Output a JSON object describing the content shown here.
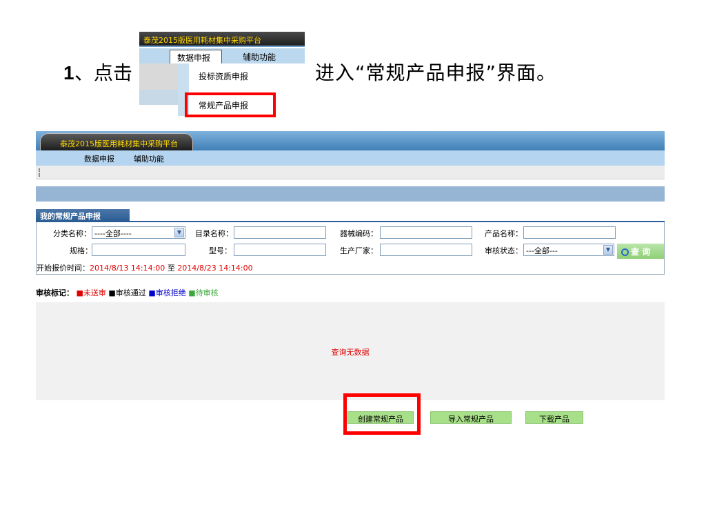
{
  "instruction": {
    "number": "1",
    "pre": "、点击",
    "post": "进入“常规产品申报”界面。"
  },
  "mini_menu": {
    "platform_title": "泰茂2015版医用耗材集中采购平台",
    "menu_data_declare": "数据申报",
    "menu_aux": "辅助功能",
    "dropdown_item_1": "投标资质申报",
    "dropdown_item_2": "常规产品申报"
  },
  "header": {
    "platform_title": "泰茂2015版医用耗材集中采购平台"
  },
  "nav": {
    "items": [
      {
        "label": "数据申报"
      },
      {
        "label": "辅助功能"
      }
    ]
  },
  "panel": {
    "tab_title": "我的常规产品申报"
  },
  "form": {
    "category_label": "分类名称：",
    "category_value": "----全部----",
    "catalog_label": "目录名称：",
    "device_code_label": "器械编码：",
    "product_name_label": "产品名称：",
    "spec_label": "规格：",
    "model_label": "型号：",
    "manufacturer_label": "生产厂家：",
    "audit_status_label": "审核状态：",
    "audit_status_value": "---全部---",
    "query_button": "查 询",
    "time_label": "开始报价时间：",
    "time_start": "2014/8/13 14:14:00",
    "time_to": "至",
    "time_end": "2014/8/23 14:14:00"
  },
  "legend": {
    "title": "审核标记：",
    "items": [
      {
        "label": "■未送审",
        "color": "#e00000"
      },
      {
        "label": "■审核通过",
        "color": "#000000"
      },
      {
        "label": "■审核拒绝",
        "color": "#0000cc"
      },
      {
        "label": "■待审核",
        "color": "#3aa83a"
      }
    ]
  },
  "result": {
    "empty_message": "查询无数据"
  },
  "actions": {
    "create": "创建常规产品",
    "import": "导入常规产品",
    "download": "下载产品"
  }
}
